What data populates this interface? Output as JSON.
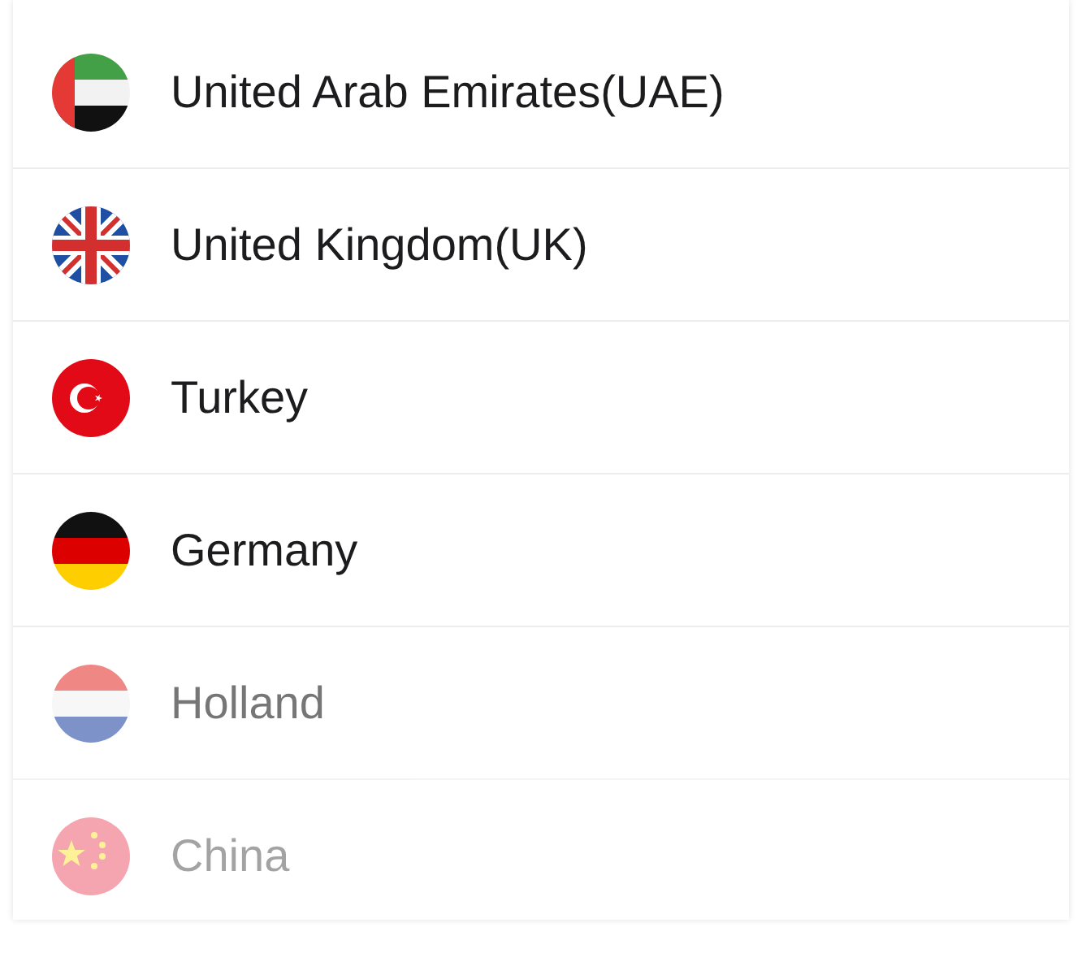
{
  "countries": [
    {
      "name": "United Arab Emirates(UAE)",
      "kind": "uae"
    },
    {
      "name": "United Kingdom(UK)",
      "kind": "uk"
    },
    {
      "name": "Turkey",
      "kind": "turkey"
    },
    {
      "name": "Germany",
      "kind": "germany"
    },
    {
      "name": "Holland",
      "kind": "netherlands"
    },
    {
      "name": "China",
      "kind": "china"
    }
  ]
}
